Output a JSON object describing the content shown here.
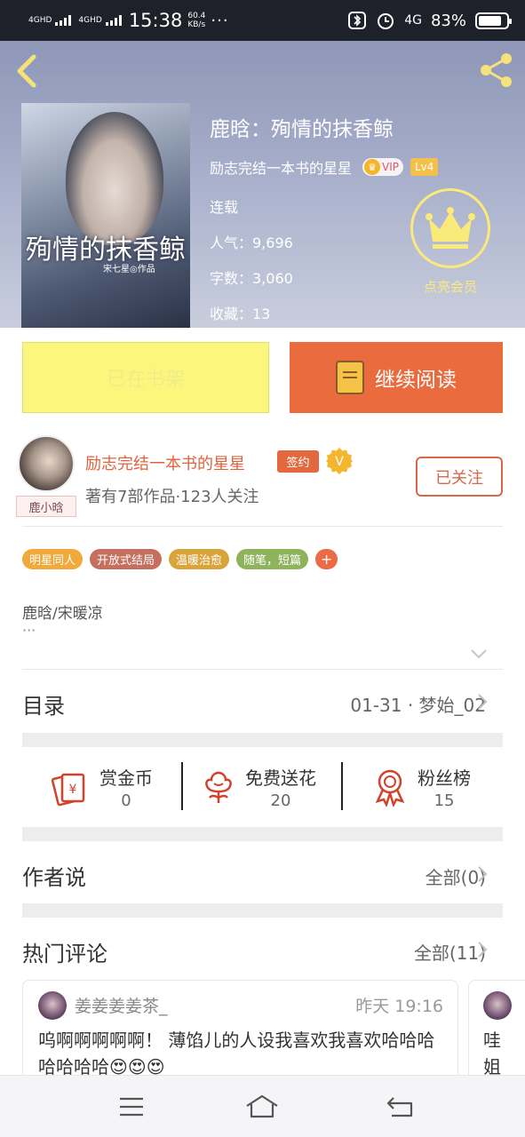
{
  "status_bar": {
    "network1": "4G",
    "network1_sup": "HD",
    "network2": "4G",
    "network2_sup": "HD",
    "time": "15:38",
    "speed_value": "60.4",
    "speed_unit": "KB/s",
    "more": "···",
    "network_right": "4G",
    "battery_percent": "83%",
    "battery_level": 0.83
  },
  "header": {
    "book_title": "鹿晗：殉情的抹香鲸",
    "author_name": "励志完结一本书的星星",
    "vip_label": "VIP",
    "level_label": "Lv4",
    "status": "连载",
    "popularity": "人气：9,696",
    "word_count": "字数：3,060",
    "favorites": "收藏：13",
    "member_label": "点亮会员",
    "cover_title": "殉情的抹香鲸",
    "cover_subtitle": "宋七星◎作品"
  },
  "actions": {
    "shelf_label": "已在书架",
    "read_label": "继续阅读"
  },
  "author_card": {
    "name": "励志完结一本书的星星",
    "sign_badge": "签约",
    "verified_badge": "V",
    "stats": "著有7部作品·123人关注",
    "follow_label": "已关注",
    "avatar_tag": "鹿小晗"
  },
  "tags": [
    {
      "label": "明星同人",
      "color": "#f0a93a"
    },
    {
      "label": "开放式结局",
      "color": "#c5705e"
    },
    {
      "label": "温暖治愈",
      "color": "#d9a43a"
    },
    {
      "label": "随笔，短篇",
      "color": "#8fb35d"
    },
    {
      "label": "+",
      "color": "#eb6b45"
    }
  ],
  "intro": {
    "text": "鹿晗/宋暖凉",
    "more": "···"
  },
  "catalog": {
    "title": "目录",
    "latest": "01-31 · 梦始_02"
  },
  "stats": {
    "reward": {
      "label": "赏金币",
      "value": "0"
    },
    "flowers": {
      "label": "免费送花",
      "value": "20"
    },
    "fans": {
      "label": "粉丝榜",
      "value": "15"
    }
  },
  "author_says": {
    "title": "作者说",
    "all_label": "全部(0)"
  },
  "hot_comments": {
    "title": "热门评论",
    "all_label": "全部(11)",
    "items": [
      {
        "user": "姜姜姜姜茶_",
        "time": "昨天 19:16",
        "text": "呜啊啊啊啊啊！ 薄馅儿的人设我喜欢我喜欢哈哈哈哈哈哈哈😍😍😍"
      },
      {
        "text": "哇姐"
      }
    ]
  },
  "colors": {
    "accent": "#ea6b3e",
    "shelf_button": "#fcf67c",
    "member_gold": "#f9ea7a"
  }
}
